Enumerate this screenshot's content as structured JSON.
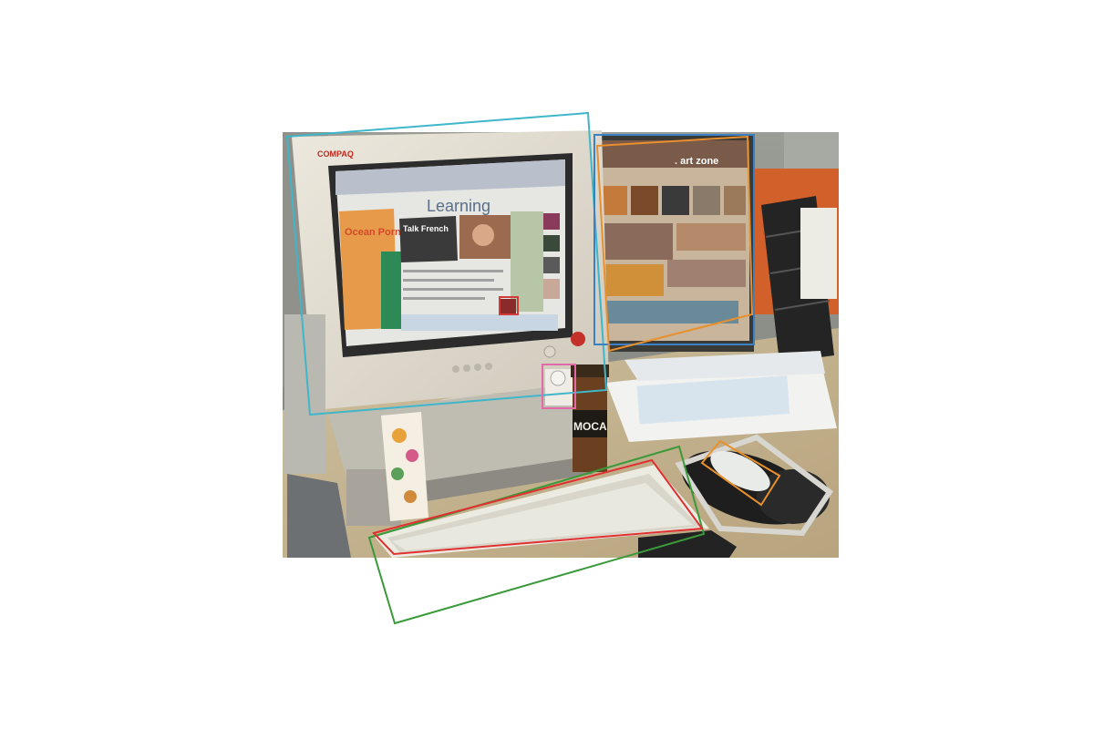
{
  "photo": {
    "monitor_brand": "COMPAQ",
    "left_screen": {
      "headline": "Learning",
      "feature_heading": "Talk French",
      "left_logo": "Ocean Porn"
    },
    "right_screen": {
      "header": ". art zone"
    },
    "jar_label": "MOCA"
  },
  "annotations": [
    {
      "name": "cyan-box",
      "color": "#3fb6c9"
    },
    {
      "name": "blue-box",
      "color": "#3b7fc4"
    },
    {
      "name": "orange-screen-box",
      "color": "#e8902d"
    },
    {
      "name": "pink-box",
      "color": "#e26aa8"
    },
    {
      "name": "red-face-box",
      "color": "#d43a3a"
    },
    {
      "name": "green-keyboard-box",
      "color": "#3a9a3a"
    },
    {
      "name": "red-keyboard-box",
      "color": "#e03030"
    },
    {
      "name": "orange-mouse-box",
      "color": "#e8902d"
    }
  ]
}
